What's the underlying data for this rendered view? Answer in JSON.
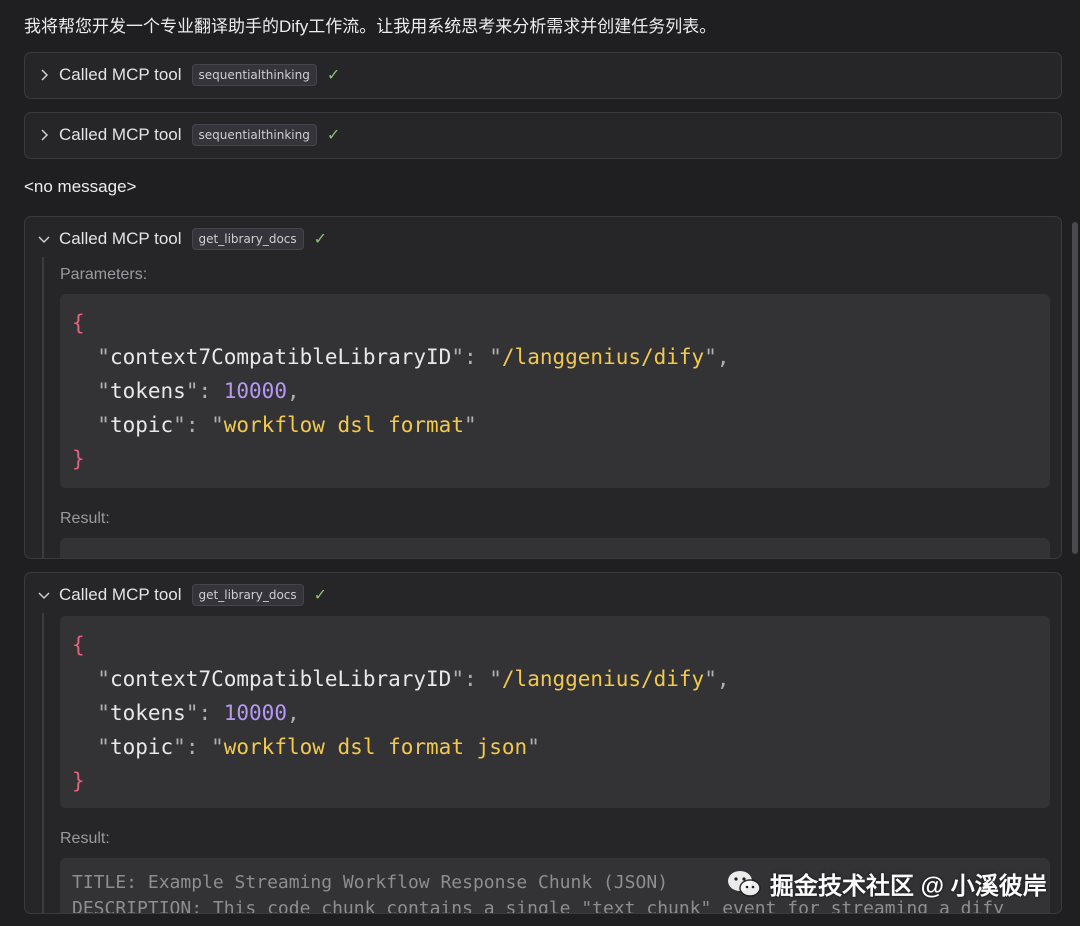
{
  "intro_text": "我将帮您开发一个专业翻译助手的Dify工作流。让我用系统思考来分析需求并创建任务列表。",
  "tool_calls": [
    {
      "label": "Called MCP tool",
      "tool": "sequentialthinking",
      "status": "✓",
      "expanded": false
    },
    {
      "label": "Called MCP tool",
      "tool": "sequentialthinking",
      "status": "✓",
      "expanded": false
    },
    {
      "label": "Called MCP tool",
      "tool": "get_library_docs",
      "status": "✓",
      "expanded": true,
      "parameters_label": "Parameters:",
      "params": {
        "k1": "context7CompatibleLibraryID",
        "v1": "/langgenius/dify",
        "k2": "tokens",
        "v2": "10000",
        "k3": "topic",
        "v3": "workflow dsl format"
      },
      "result_label": "Result:"
    },
    {
      "label": "Called MCP tool",
      "tool": "get_library_docs",
      "status": "✓",
      "expanded": true,
      "params": {
        "k1": "context7CompatibleLibraryID",
        "v1": "/langgenius/dify",
        "k2": "tokens",
        "v2": "10000",
        "k3": "topic",
        "v3": "workflow dsl format json"
      },
      "result_label": "Result:",
      "result_line1": "TITLE: Example Streaming Workflow Response Chunk (JSON)",
      "result_line2": "DESCRIPTION: This code chunk contains a single \"text_chunk\" event for streaming a dify"
    }
  ],
  "no_message": "<no message>",
  "watermark": "掘金技术社区 @ 小溪彼岸"
}
